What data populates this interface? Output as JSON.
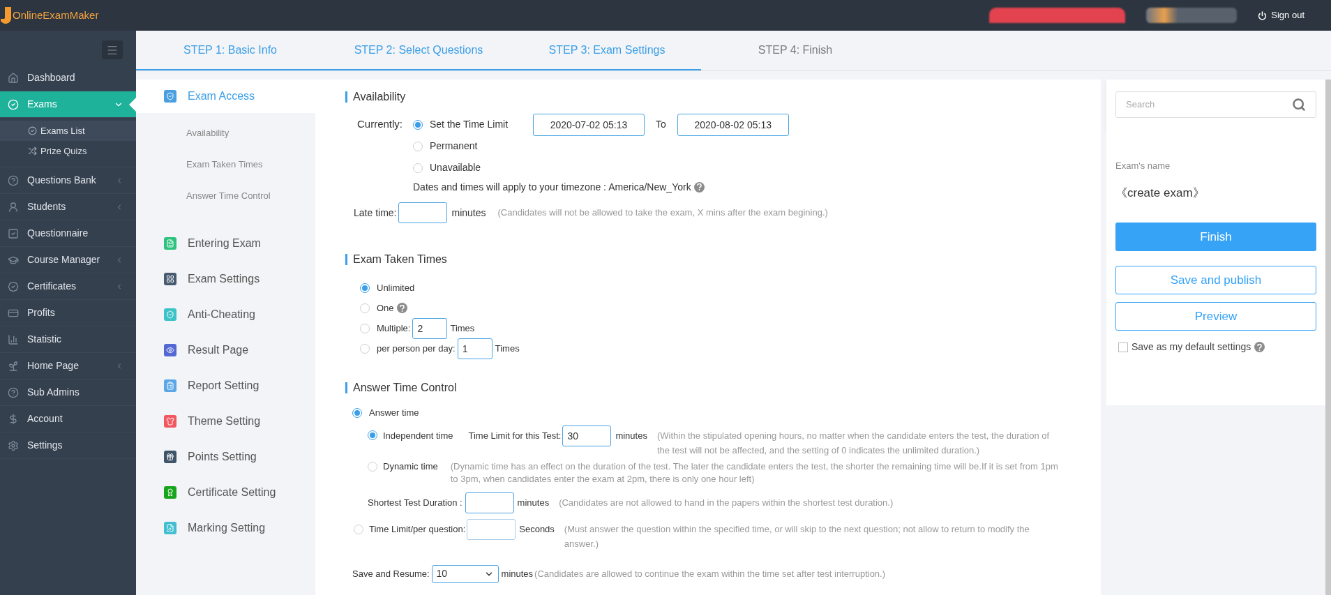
{
  "header": {
    "logo_text": "OnlineExamMaker",
    "sign_out": "Sign out"
  },
  "sidebar": {
    "items": [
      {
        "label": "Dashboard",
        "selected": false,
        "expandable": false
      },
      {
        "label": "Exams",
        "selected": true,
        "expandable": true,
        "expanded": true,
        "children": [
          {
            "label": "Exams List",
            "selected": true
          },
          {
            "label": "Prize Quizs",
            "selected": false
          }
        ]
      },
      {
        "label": "Questions Bank",
        "selected": false,
        "expandable": true,
        "expanded": false
      },
      {
        "label": "Students",
        "selected": false,
        "expandable": true,
        "expanded": false
      },
      {
        "label": "Questionnaire",
        "selected": false,
        "expandable": false
      },
      {
        "label": "Course Manager",
        "selected": false,
        "expandable": true,
        "expanded": false
      },
      {
        "label": "Certificates",
        "selected": false,
        "expandable": true,
        "expanded": false
      },
      {
        "label": "Profits",
        "selected": false,
        "expandable": false
      },
      {
        "label": "Statistic",
        "selected": false,
        "expandable": false
      },
      {
        "label": "Home Page",
        "selected": false,
        "expandable": true,
        "expanded": false
      },
      {
        "label": "Sub Admins",
        "selected": false,
        "expandable": false
      },
      {
        "label": "Account",
        "selected": false,
        "expandable": false
      },
      {
        "label": "Settings",
        "selected": false,
        "expandable": false
      }
    ]
  },
  "steps": [
    {
      "label": "STEP 1: Basic Info",
      "done": true
    },
    {
      "label": "STEP 2: Select Questions",
      "done": true
    },
    {
      "label": "STEP 3: Exam Settings",
      "done": true
    },
    {
      "label": "STEP 4: Finish",
      "done": false
    }
  ],
  "settings_menu": [
    {
      "label": "Exam Access",
      "color": "#4a9fe0",
      "selected": true,
      "children": [
        {
          "label": "Availability"
        },
        {
          "label": "Exam Taken Times"
        },
        {
          "label": "Answer Time Control"
        }
      ]
    },
    {
      "label": "Entering Exam",
      "color": "#2ec27e",
      "selected": false
    },
    {
      "label": "Exam Settings",
      "color": "#475a70",
      "selected": false
    },
    {
      "label": "Anti-Cheating",
      "color": "#3cc3c8",
      "selected": false
    },
    {
      "label": "Result Page",
      "color": "#5468d4",
      "selected": false
    },
    {
      "label": "Report Setting",
      "color": "#5aa6e6",
      "selected": false
    },
    {
      "label": "Theme Setting",
      "color": "#f0575f",
      "selected": false
    },
    {
      "label": "Points Setting",
      "color": "#3f5468",
      "selected": false
    },
    {
      "label": "Certificate Setting",
      "color": "#16a51c",
      "selected": false
    },
    {
      "label": "Marking Setting",
      "color": "#41bfd0",
      "selected": false
    }
  ],
  "availability": {
    "title": "Availability",
    "currently_label": "Currently:",
    "options": [
      {
        "label": "Set the Time Limit",
        "selected": true
      },
      {
        "label": "Permanent",
        "selected": false
      },
      {
        "label": "Unavailable",
        "selected": false
      }
    ],
    "start": "2020-07-02 05:13",
    "to": "To",
    "end": "2020-08-02 05:13",
    "timezone_note": "Dates and times will apply to your timezone : America/New_York",
    "late_time_label": "Late time:",
    "late_time_unit": "minutes",
    "late_time_note": "(Candidates will not be allowed to take the exam, X mins after the exam begining.)"
  },
  "taken_times": {
    "title": "Exam Taken Times",
    "options": [
      {
        "kind": "plain",
        "label": "Unlimited",
        "selected": true
      },
      {
        "kind": "help",
        "label": "One",
        "selected": false
      },
      {
        "kind": "input",
        "label": "Multiple:",
        "value": "2",
        "unit": "Times",
        "selected": false
      },
      {
        "kind": "input",
        "label": "per person per day:",
        "value": "1",
        "unit": "Times",
        "selected": false
      }
    ]
  },
  "answer_time": {
    "title": "Answer Time Control",
    "answer_time": {
      "label": "Answer time",
      "selected": true
    },
    "independent": {
      "label": "Independent time",
      "selected": true,
      "limit_label": "Time Limit for this Test:",
      "value": "30",
      "unit": "minutes",
      "note": "(Within the stipulated opening hours, no matter when the candidate enters the test, the duration of the test will not be affected, and the setting of 0 indicates the unlimited duration.)"
    },
    "dynamic": {
      "label": "Dynamic time",
      "selected": false,
      "note": "(Dynamic time has an effect on the duration of the test. The later the candidate enters the test, the shorter the remaining time will be.If it is set from 1pm to 3pm, when candidates enter the exam at 2pm, there is only one hour left)"
    },
    "shortest": {
      "label": "Shortest Test Duration :",
      "unit": "minutes",
      "note": "(Candidates are not allowed to hand in the papers within the shortest test duration.)"
    },
    "per_question": {
      "label": "Time Limit/per question:",
      "selected": false,
      "unit": "Seconds",
      "note": "(Must answer the question within the specified time, or will skip to the next question; not allow to return to modify the answer.)"
    },
    "save_resume": {
      "label": "Save and Resume:",
      "value": "10",
      "unit": "minutes",
      "note": "(Candidates are allowed to continue the exam within the time set after test interruption.)"
    }
  },
  "right_panel": {
    "search_placeholder": "Search",
    "exam_name_label": "Exam's name",
    "exam_name": "《create exam》",
    "buttons": [
      {
        "label": "Finish",
        "kind": "primary"
      },
      {
        "label": "Save and publish",
        "kind": "outline"
      },
      {
        "label": "Preview",
        "kind": "outline"
      }
    ],
    "default_settings": {
      "label": "Save as my default settings",
      "checked": false
    }
  }
}
